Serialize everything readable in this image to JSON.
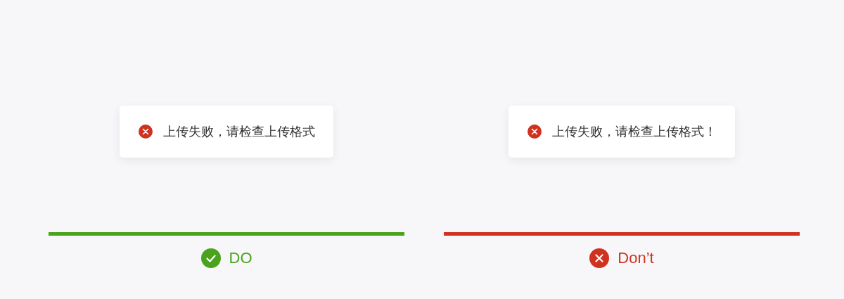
{
  "panels": [
    {
      "toast": {
        "message": "上传失败，请检查上传格式"
      },
      "verdict": {
        "kind": "do",
        "label": "DO",
        "color": "#4aa31c"
      }
    },
    {
      "toast": {
        "message": "上传失败，请检查上传格式！"
      },
      "verdict": {
        "kind": "dont",
        "label": "Don’t",
        "color": "#d0321f"
      }
    }
  ]
}
